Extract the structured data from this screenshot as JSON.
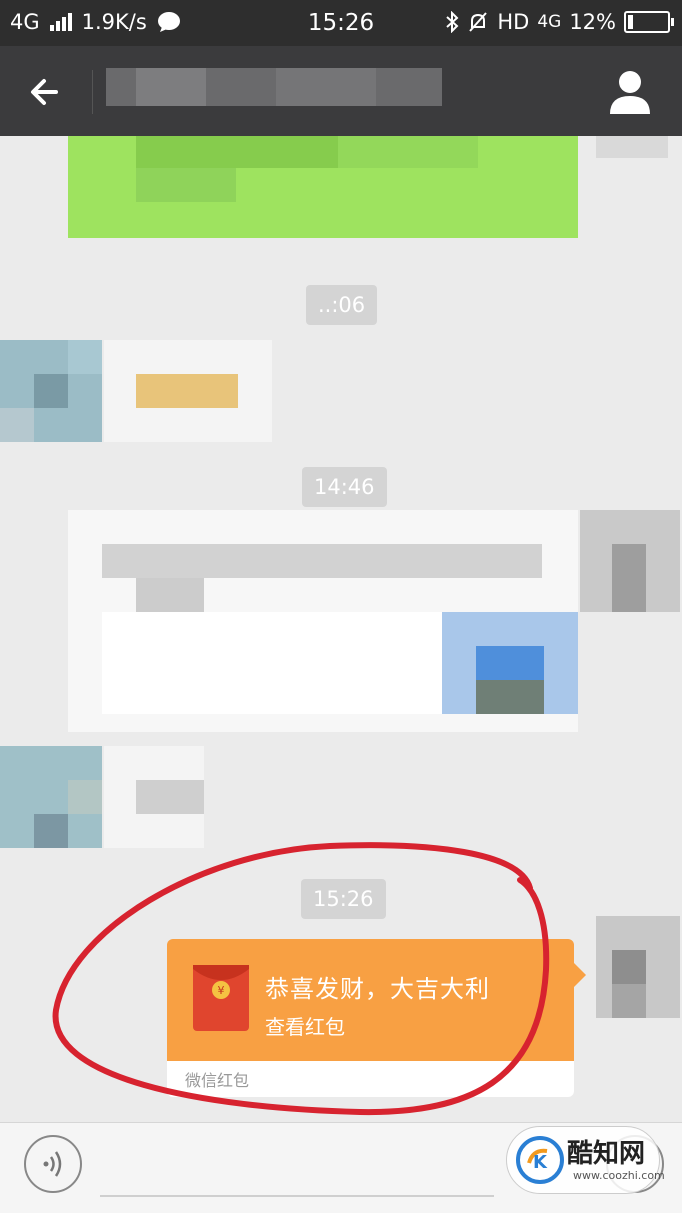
{
  "status_bar": {
    "network": "4G",
    "speed": "1.9K/s",
    "time": "15:26",
    "hd_label": "HD",
    "network_right": "4G",
    "battery": "12%",
    "battery_level": 0.12
  },
  "header": {
    "back_icon": "arrow-left-icon",
    "profile_icon": "person-icon"
  },
  "messages": {
    "timestamp_1": "..:06",
    "timestamp_2": "14:46",
    "timestamp_3": "15:26",
    "red_packet": {
      "title": "恭喜发财，大吉大利",
      "action": "查看红包",
      "footer": "微信红包",
      "icon": "red-envelope-icon"
    }
  },
  "input_bar": {
    "voice_icon": "voice-icon",
    "plus_icon": "plus-icon"
  },
  "watermark": {
    "name": "酷知网",
    "url": "www.coozhi.com"
  },
  "colors": {
    "status_bg": "#2e2e2e",
    "title_bg": "#3b3b3d",
    "chat_bg": "#ebebeb",
    "red_packet_orange": "#f8a043",
    "sent_green": "#9ee35f",
    "annotation_red": "#d7232f"
  }
}
